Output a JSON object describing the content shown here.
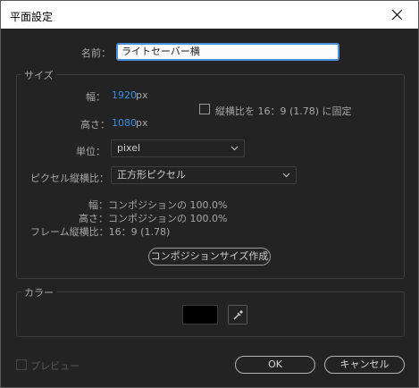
{
  "window": {
    "title": "平面設定"
  },
  "name": {
    "label": "名前：",
    "value": "ライトセーバー横"
  },
  "size": {
    "group_title": "サイズ",
    "width_label": "幅：",
    "width_value": "1920",
    "width_unit": "px",
    "height_label": "高さ：",
    "height_value": "1080",
    "height_unit": "px",
    "lock_label": "縦横比を 16：9 (1.78) に固定",
    "lock_checked": false,
    "units_label": "単位：",
    "units_value": "pixel",
    "par_label": "ピクセル縦横比：",
    "par_value": "正方形ピクセル",
    "info_width": "幅：コンポジションの 100.0%",
    "info_height": "高さ：コンポジションの 100.0%",
    "info_frame": "フレーム縦横比：16：9 (1.78)",
    "make_comp_size": "コンポジションサイズ作成"
  },
  "color": {
    "group_title": "カラー",
    "swatch": "#000000"
  },
  "footer": {
    "preview_label": "プレビュー",
    "preview_checked": false,
    "ok": "OK",
    "cancel": "キャンセル"
  }
}
